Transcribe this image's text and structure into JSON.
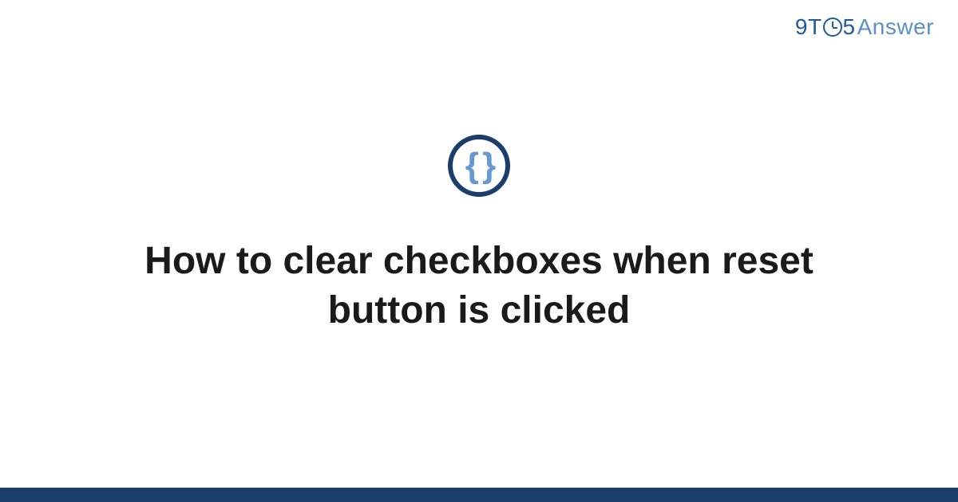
{
  "logo": {
    "part1": "9",
    "part2": "T",
    "part3": "5",
    "part4": "Answer"
  },
  "category": {
    "icon_name": "code-braces-icon",
    "symbol": "{ }"
  },
  "main": {
    "title": "How to clear checkboxes when reset button is clicked"
  },
  "colors": {
    "brand_dark": "#1a3d6b",
    "brand_blue": "#1e5a9e",
    "brand_light": "#5a8fc7",
    "icon_fill": "#6699d1"
  }
}
